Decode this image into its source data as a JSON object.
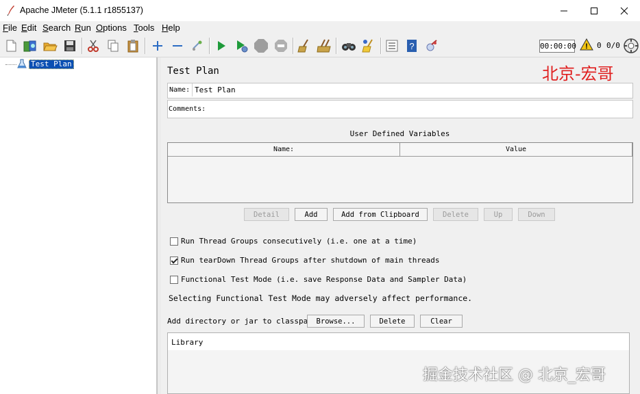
{
  "window": {
    "title": "Apache JMeter (5.1.1 r1855137)",
    "controls": [
      "minimize-icon",
      "maximize-icon",
      "close-icon"
    ]
  },
  "menubar": {
    "items": [
      {
        "label": "File",
        "mnemonic": "F",
        "rest": "ile"
      },
      {
        "label": "Edit",
        "mnemonic": "E",
        "rest": "dit"
      },
      {
        "label": "Search",
        "mnemonic": "S",
        "rest": "earch"
      },
      {
        "label": "Run",
        "mnemonic": "R",
        "rest": "un"
      },
      {
        "label": "Options",
        "mnemonic": "O",
        "rest": "ptions"
      },
      {
        "label": "Tools",
        "mnemonic": "T",
        "rest": "ools"
      },
      {
        "label": "Help",
        "mnemonic": "H",
        "rest": "elp"
      }
    ]
  },
  "toolbar": {
    "icons": [
      "new-icon",
      "templates-icon",
      "open-icon",
      "save-icon",
      "cut-icon",
      "copy-icon",
      "paste-icon",
      "expand-icon",
      "collapse-icon",
      "toggle-icon",
      "start-icon",
      "start-no-pause-icon",
      "stop-icon",
      "shutdown-icon",
      "clear-icon",
      "clear-all-icon",
      "search-icon",
      "reset-search-icon",
      "function-helper-icon",
      "help-icon",
      "remote-icon"
    ],
    "timer": "00:00:00",
    "warning_count": "0",
    "threads": "0/0"
  },
  "tree": {
    "root_label": "Test Plan"
  },
  "panel": {
    "title": "Test Plan",
    "name_label": "Name:",
    "name_value": "Test Plan",
    "comments_label": "Comments:",
    "comments_value": "",
    "udv_title": "User Defined Variables",
    "udv_columns": [
      "Name:",
      "Value"
    ],
    "buttons": {
      "detail": "Detail",
      "add": "Add",
      "add_clipboard": "Add from Clipboard",
      "delete": "Delete",
      "up": "Up",
      "down": "Down"
    },
    "checkboxes": [
      {
        "label": "Run Thread Groups consecutively (i.e. one at a time)",
        "checked": false
      },
      {
        "label": "Run tearDown Thread Groups after shutdown of main threads",
        "checked": true
      },
      {
        "label": "Functional Test Mode (i.e. save Response Data and Sampler Data)",
        "checked": false
      }
    ],
    "functional_note": "Selecting Functional Test Mode may adversely affect performance.",
    "classpath_label": "Add directory or jar to classpath",
    "classpath_buttons": {
      "browse": "Browse...",
      "delete": "Delete",
      "clear": "Clear"
    },
    "library_header": "Library"
  },
  "watermarks": {
    "top": "北京-宏哥",
    "bottom": "掘金技术社区 @ 北京_宏哥"
  }
}
